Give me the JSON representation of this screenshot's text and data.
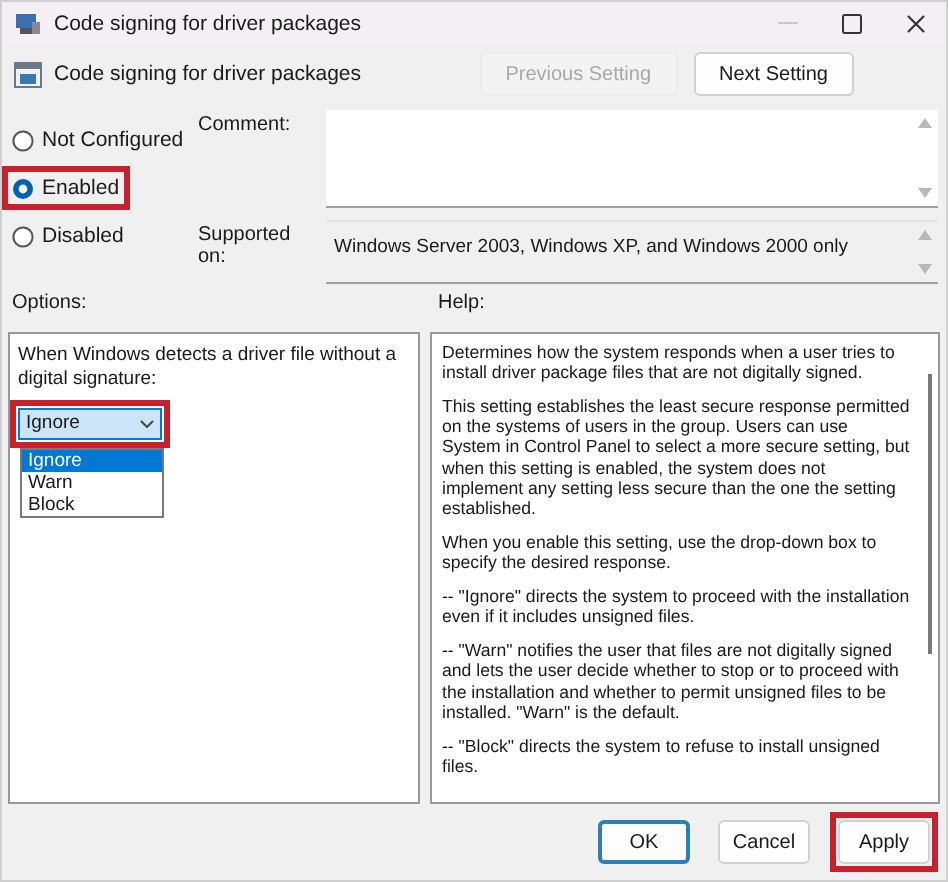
{
  "window": {
    "title": "Code signing for driver packages"
  },
  "header": {
    "title": "Code signing for driver packages",
    "buttons": [
      {
        "label": "Previous Setting",
        "disabled": true
      },
      {
        "label": "Next Setting",
        "disabled": false
      }
    ]
  },
  "state_options": [
    {
      "label": "Not Configured",
      "selected": false,
      "highlighted": false
    },
    {
      "label": "Enabled",
      "selected": true,
      "highlighted": true
    },
    {
      "label": "Disabled",
      "selected": false,
      "highlighted": false
    }
  ],
  "comment": {
    "label": "Comment:"
  },
  "supported_on": {
    "label": "Supported on:",
    "value": "Windows Server 2003, Windows XP, and Windows 2000 only"
  },
  "options": {
    "label": "Options:",
    "prompt": "When Windows detects a driver file without a digital signature:",
    "dropdown": {
      "value": "Ignore",
      "expanded": true,
      "highlighted": true,
      "items": [
        {
          "label": "Ignore",
          "selected": true
        },
        {
          "label": "Warn",
          "selected": false
        },
        {
          "label": "Block",
          "selected": false
        }
      ]
    }
  },
  "help": {
    "label": "Help:",
    "paragraphs": [
      "Determines how the system responds when a user tries to install driver package files that are not digitally signed.",
      "This setting establishes the least secure response permitted on the systems of users in the group. Users can use System in Control Panel to select a more secure setting, but when this setting is enabled, the system does not implement any setting less secure than the one the setting established.",
      "When you enable this setting, use the drop-down box to specify the desired response.",
      "--   \"Ignore\" directs the system to proceed with the installation even if it includes unsigned files.",
      "--   \"Warn\" notifies the user that files are not digitally signed and lets the user decide whether to stop or to proceed with the installation and whether to permit unsigned files to be installed. \"Warn\" is the default.",
      "--   \"Block\" directs the system to refuse to install unsigned files."
    ]
  },
  "footer_buttons": [
    {
      "label": "OK",
      "default": true,
      "highlighted": false
    },
    {
      "label": "Cancel",
      "default": false,
      "highlighted": false
    },
    {
      "label": "Apply",
      "default": false,
      "highlighted": true
    }
  ]
}
